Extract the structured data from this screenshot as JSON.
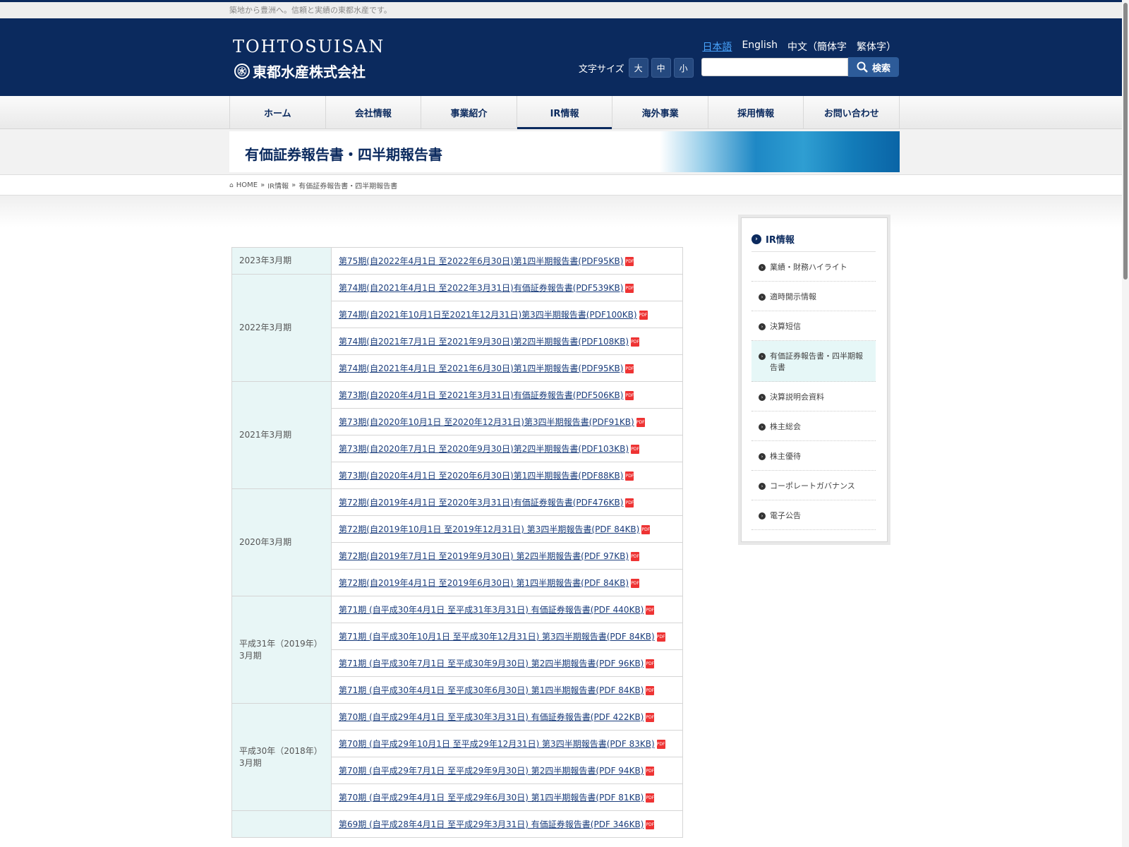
{
  "tagline": "築地から豊洲へ。信頼と実績の東都水産です。",
  "logo": {
    "en": "TOHTOSUISAN",
    "mark": "㊌",
    "jp": "東都水産株式会社"
  },
  "languages": [
    "日本語",
    "English",
    "中文（簡体字",
    "繁体字）"
  ],
  "font_size": {
    "label": "文字サイズ",
    "large": "大",
    "medium": "中",
    "small": "小"
  },
  "search": {
    "placeholder": "",
    "button": "検索"
  },
  "nav": [
    "ホーム",
    "会社情報",
    "事業紹介",
    "IR情報",
    "海外事業",
    "採用情報",
    "お問い合わせ"
  ],
  "page_title": "有価証券報告書・四半期報告書",
  "breadcrumb": {
    "home": "HOME",
    "sep1": "»",
    "ir": "IR情報",
    "sep2": "»",
    "current": "有価証券報告書・四半期報告書"
  },
  "pdf_label": "PDF",
  "table": {
    "periods": [
      "2023年3月期",
      "2022年3月期",
      "2021年3月期",
      "2020年3月期",
      "平成31年（2019年）3月期",
      "平成30年（2018年）3月期"
    ],
    "docs": [
      "第75期(自2022年4月1日 至2022年6月30日)第1四半期報告書(PDF95KB)",
      "第74期(自2021年4月1日 至2022年3月31日)有価証券報告書(PDF539KB)",
      "第74期(自2021年10月1日至2021年12月31日)第3四半期報告書(PDF100KB)",
      "第74期(自2021年7月1日 至2021年9月30日)第2四半期報告書(PDF108KB)",
      "第74期(自2021年4月1日 至2021年6月30日)第1四半期報告書(PDF95KB)",
      "第73期(自2020年4月1日 至2021年3月31日)有価証券報告書(PDF506KB)",
      "第73期(自2020年10月1日 至2020年12月31日)第3四半期報告書(PDF91KB)",
      "第73期(自2020年7月1日 至2020年9月30日)第2四半期報告書(PDF103KB)",
      "第73期(自2020年4月1日 至2020年6月30日)第1四半期報告書(PDF88KB)",
      "第72期(自2019年4月1日 至2020年3月31日)有価証券報告書(PDF476KB)",
      "第72期(自2019年10月1日 至2019年12月31日) 第3四半期報告書(PDF 84KB)",
      "第72期(自2019年7月1日 至2019年9月30日) 第2四半期報告書(PDF 97KB)",
      "第72期(自2019年4月1日 至2019年6月30日) 第1四半期報告書(PDF 84KB)",
      "第71期 (自平成30年4月1日 至平成31年3月31日) 有価証券報告書(PDF 440KB)",
      "第71期 (自平成30年10月1日 至平成30年12月31日) 第3四半期報告書(PDF 84KB)",
      "第71期 (自平成30年7月1日 至平成30年9月30日) 第2四半期報告書(PDF 96KB)",
      "第71期 (自平成30年4月1日 至平成30年6月30日) 第1四半期報告書(PDF 84KB)",
      "第70期 (自平成29年4月1日 至平成30年3月31日) 有価証券報告書(PDF 422KB)",
      "第70期 (自平成29年10月1日 至平成29年12月31日) 第3四半期報告書(PDF 83KB)",
      "第70期 (自平成29年7月1日 至平成29年9月30日) 第2四半期報告書(PDF 94KB)",
      "第70期 (自平成29年4月1日 至平成29年6月30日) 第1四半期報告書(PDF 81KB)",
      "第69期 (自平成28年4月1日 至平成29年3月31日) 有価証券報告書(PDF 346KB)"
    ]
  },
  "sidebar": {
    "title": "IR情報",
    "items": [
      "業績・財務ハイライト",
      "適時開示情報",
      "決算短信",
      "有価証券報告書・四半期報告書",
      "決算説明会資料",
      "株主総会",
      "株主優待",
      "コーポレートガバナンス",
      "電子公告"
    ]
  }
}
